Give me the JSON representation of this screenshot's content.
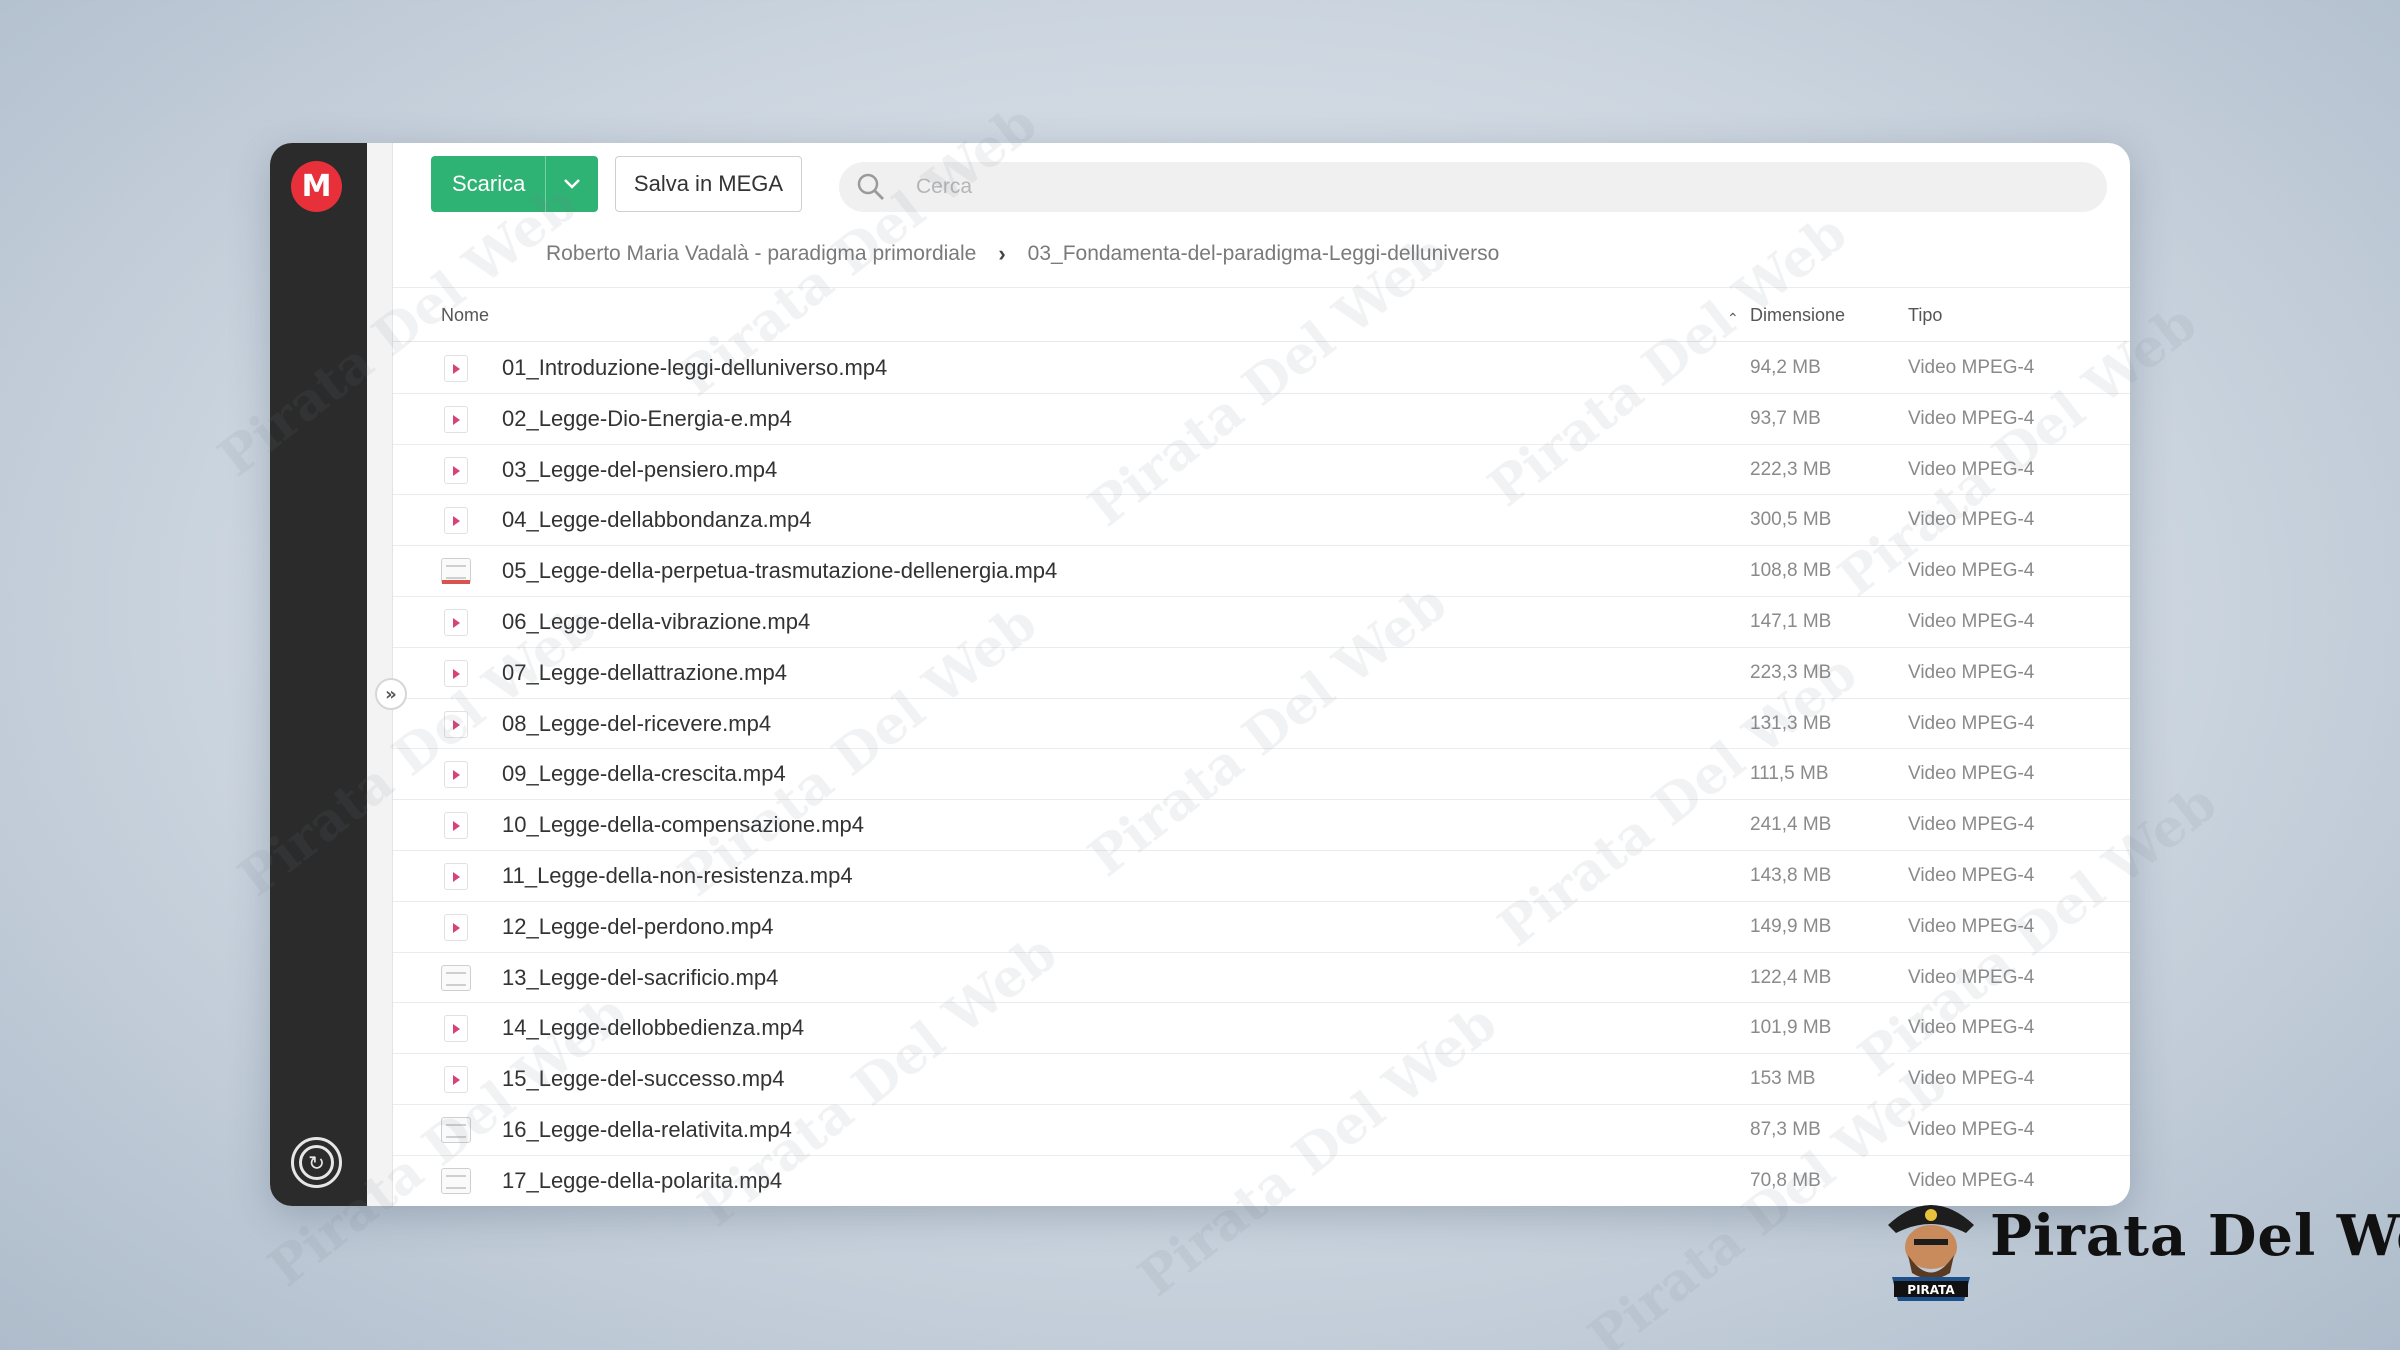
{
  "toolbar": {
    "download_label": "Scarica",
    "save_label": "Salva in MEGA",
    "search_placeholder": "Cerca"
  },
  "breadcrumb": {
    "parent": "Roberto Maria Vadalà - paradigma primordiale",
    "current": "03_Fondamenta-del-paradigma-Leggi-delluniverso"
  },
  "columns": {
    "name": "Nome",
    "size": "Dimensione",
    "type": "Tipo"
  },
  "files": [
    {
      "name": "01_Introduzione-leggi-delluniverso.mp4",
      "size": "94,2 MB",
      "type": "Video MPEG-4",
      "icon": "video"
    },
    {
      "name": "02_Legge-Dio-Energia-e.mp4",
      "size": "93,7 MB",
      "type": "Video MPEG-4",
      "icon": "video"
    },
    {
      "name": "03_Legge-del-pensiero.mp4",
      "size": "222,3 MB",
      "type": "Video MPEG-4",
      "icon": "video"
    },
    {
      "name": "04_Legge-dellabbondanza.mp4",
      "size": "300,5 MB",
      "type": "Video MPEG-4",
      "icon": "video"
    },
    {
      "name": "05_Legge-della-perpetua-trasmutazione-dellenergia.mp4",
      "size": "108,8 MB",
      "type": "Video MPEG-4",
      "icon": "thumbnail"
    },
    {
      "name": "06_Legge-della-vibrazione.mp4",
      "size": "147,1 MB",
      "type": "Video MPEG-4",
      "icon": "video"
    },
    {
      "name": "07_Legge-dellattrazione.mp4",
      "size": "223,3 MB",
      "type": "Video MPEG-4",
      "icon": "video"
    },
    {
      "name": "08_Legge-del-ricevere.mp4",
      "size": "131,3 MB",
      "type": "Video MPEG-4",
      "icon": "video"
    },
    {
      "name": "09_Legge-della-crescita.mp4",
      "size": "111,5 MB",
      "type": "Video MPEG-4",
      "icon": "video"
    },
    {
      "name": "10_Legge-della-compensazione.mp4",
      "size": "241,4 MB",
      "type": "Video MPEG-4",
      "icon": "video"
    },
    {
      "name": "11_Legge-della-non-resistenza.mp4",
      "size": "143,8 MB",
      "type": "Video MPEG-4",
      "icon": "video"
    },
    {
      "name": "12_Legge-del-perdono.mp4",
      "size": "149,9 MB",
      "type": "Video MPEG-4",
      "icon": "video"
    },
    {
      "name": "13_Legge-del-sacrificio.mp4",
      "size": "122,4 MB",
      "type": "Video MPEG-4",
      "icon": "thumbnail"
    },
    {
      "name": "14_Legge-dellobbedienza.mp4",
      "size": "101,9 MB",
      "type": "Video MPEG-4",
      "icon": "video"
    },
    {
      "name": "15_Legge-del-successo.mp4",
      "size": "153 MB",
      "type": "Video MPEG-4",
      "icon": "video"
    },
    {
      "name": "16_Legge-della-relativita.mp4",
      "size": "87,3 MB",
      "type": "Video MPEG-4",
      "icon": "thumbnail"
    },
    {
      "name": "17_Legge-della-polarita.mp4",
      "size": "70,8 MB",
      "type": "Video MPEG-4",
      "icon": "thumbnail"
    }
  ],
  "watermark": "Pirata Del Web",
  "brand": {
    "name": "Pirata Del Web",
    "badge": "PIRATA"
  },
  "colors": {
    "accent_green": "#2fb374",
    "mega_red": "#e8303a",
    "sidebar": "#2b2b2b",
    "video_icon": "#d6427a"
  }
}
